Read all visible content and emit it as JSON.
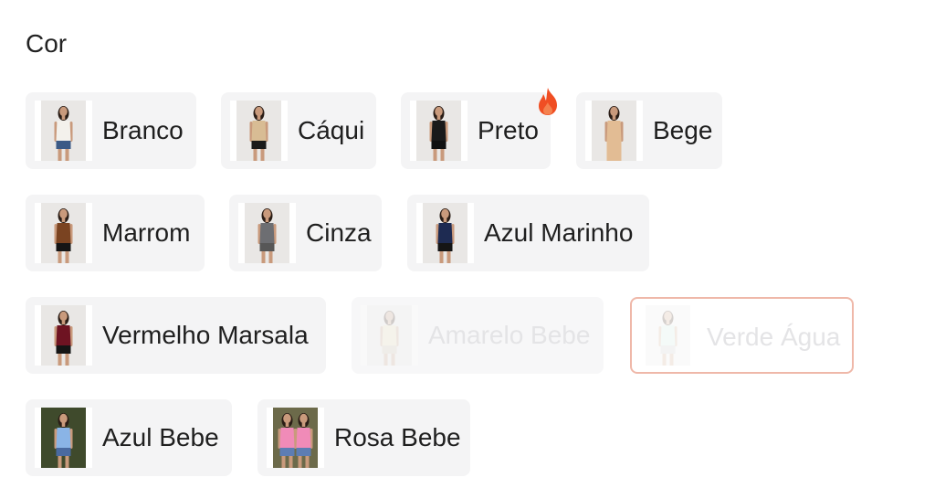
{
  "section": {
    "label": "Cor"
  },
  "options": [
    {
      "label": "Branco",
      "top_color": "#f3f1ec",
      "bottom_color": "#3b5a86",
      "skin": "#c99a7c",
      "hair": "#2a1d16",
      "bg": "#e9e7e5"
    },
    {
      "label": "Cáqui",
      "top_color": "#d8bc94",
      "bottom_color": "#1b1b1b",
      "skin": "#c99a7c",
      "hair": "#2a1d16",
      "bg": "#e9e7e5"
    },
    {
      "label": "Preto",
      "top_color": "#1a1a1a",
      "bottom_color": "#111111",
      "skin": "#c99a7c",
      "hair": "#2a1d16",
      "bg": "#e9e7e5",
      "hot": true
    },
    {
      "label": "Bege",
      "top_color": "#e2bc94",
      "bottom_color": "#e2bc94",
      "skin": "#c99a7c",
      "hair": "#2a1d16",
      "bg": "#e9e7e5",
      "full_length": true
    },
    {
      "label": "Marrom",
      "top_color": "#7a4321",
      "bottom_color": "#151515",
      "skin": "#c99a7c",
      "hair": "#2a1d16",
      "bg": "#e9e7e5"
    },
    {
      "label": "Cinza",
      "top_color": "#6d6e72",
      "bottom_color": "#575757",
      "skin": "#c99a7c",
      "hair": "#2a1d16",
      "bg": "#e9e7e5"
    },
    {
      "label": "Azul Marinho",
      "top_color": "#1e2b52",
      "bottom_color": "#151515",
      "skin": "#c99a7c",
      "hair": "#2a1d16",
      "bg": "#e9e7e5"
    },
    {
      "label": "Vermelho Marsala",
      "top_color": "#6e1322",
      "bottom_color": "#151515",
      "skin": "#c99a7c",
      "hair": "#2a1d16",
      "bg": "#e9e7e5"
    },
    {
      "label": "Amarelo Bebe",
      "top_color": "#f2e9c6",
      "bottom_color": "#d8d1c0",
      "skin": "#d6b6a0",
      "hair": "#5b4a40",
      "bg": "#efeeec",
      "disabled": true
    },
    {
      "label": "Verde Água",
      "top_color": "#d6ece6",
      "bottom_color": "#d0d0d0",
      "skin": "#d6b6a0",
      "hair": "#5b4a40",
      "bg": "#efeeec",
      "disabled": true,
      "selected": true
    },
    {
      "label": "Azul Bebe",
      "top_color": "#8ab4e6",
      "bottom_color": "#4a6aa0",
      "skin": "#c99a7c",
      "hair": "#2a1d16",
      "bg": "#3f4a2c"
    },
    {
      "label": "Rosa Bebe",
      "top_color": "#f08bb8",
      "bottom_color": "#5d7db3",
      "skin": "#c99a7c",
      "hair": "#2a1d16",
      "bg": "#6c6a4a",
      "double": true
    }
  ],
  "colors": {
    "chip_bg": "#f4f4f5",
    "selected_border": "#efb8a9",
    "hot_flame": "#f04e23",
    "hot_flame_inner": "#f7a36b"
  },
  "icons": {
    "hot": "flame-icon"
  }
}
